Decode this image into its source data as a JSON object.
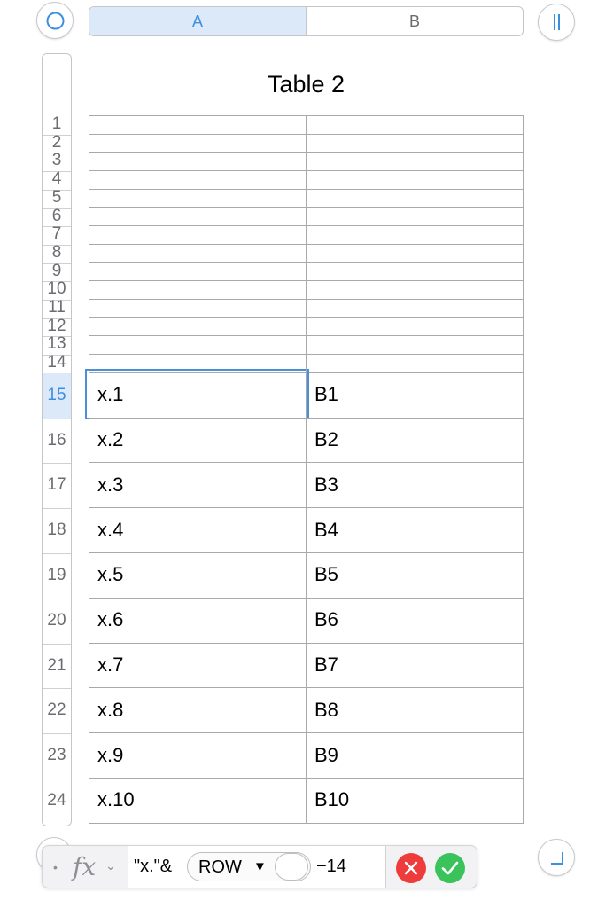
{
  "controls": {
    "select_all_icon": "circle-select-icon",
    "freeze_icon": "pause-bars-icon",
    "add_row_icon": "circle-icon",
    "resize_icon": "corner-resize-icon"
  },
  "column_headers": [
    "A",
    "B"
  ],
  "selected_column": "A",
  "table": {
    "title": "Table 2",
    "small_rows": [
      "1",
      "2",
      "3",
      "4",
      "5",
      "6",
      "7",
      "8",
      "9",
      "10",
      "11",
      "12",
      "13",
      "14"
    ],
    "rows": [
      {
        "num": "15",
        "a": "x.1",
        "b": "B1"
      },
      {
        "num": "16",
        "a": "x.2",
        "b": "B2"
      },
      {
        "num": "17",
        "a": "x.3",
        "b": "B3"
      },
      {
        "num": "18",
        "a": "x.4",
        "b": "B4"
      },
      {
        "num": "19",
        "a": "x.5",
        "b": "B5"
      },
      {
        "num": "20",
        "a": "x.6",
        "b": "B6"
      },
      {
        "num": "21",
        "a": "x.7",
        "b": "B7"
      },
      {
        "num": "22",
        "a": "x.8",
        "b": "B8"
      },
      {
        "num": "23",
        "a": "x.9",
        "b": "B9"
      },
      {
        "num": "24",
        "a": "x.10",
        "b": "B10"
      }
    ],
    "selected_row": "15"
  },
  "formula_bar": {
    "bullet": "•",
    "fx_label": "fx",
    "chevron": "⌄",
    "prefix": "\"x.\"&",
    "token_label": "ROW",
    "token_arrow": "▼",
    "suffix": "−14",
    "cancel_icon": "x-icon",
    "confirm_icon": "checkmark-icon"
  },
  "colors": {
    "accent": "#3b8fe0",
    "selection_fill": "#dce9f9",
    "cancel": "#ee3b3b",
    "confirm": "#3ac35a"
  }
}
